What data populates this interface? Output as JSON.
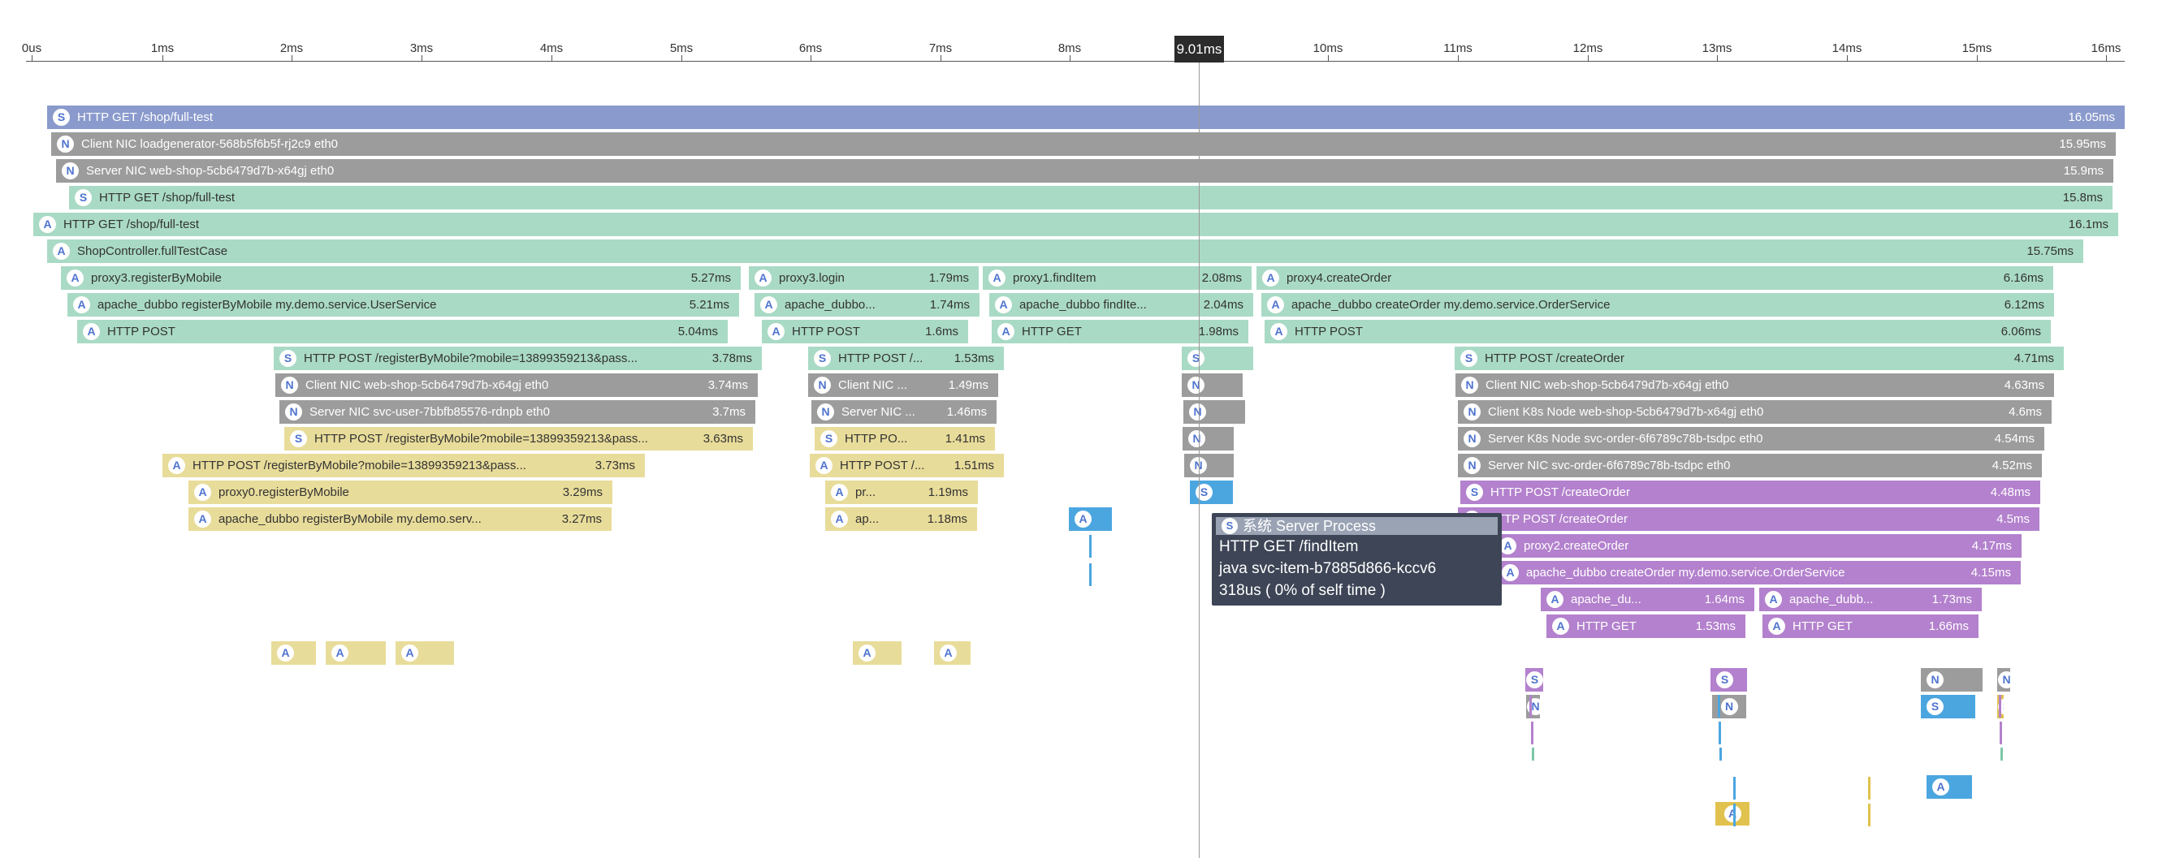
{
  "timeline": {
    "ticks": [
      "0us",
      "1ms",
      "2ms",
      "3ms",
      "4ms",
      "5ms",
      "6ms",
      "7ms",
      "8ms",
      "10ms",
      "11ms",
      "12ms",
      "13ms",
      "14ms",
      "15ms",
      "16ms"
    ],
    "cursor_label": "9.01ms"
  },
  "spans": [
    {
      "type": "S",
      "name": "HTTP GET /shop/full-test",
      "duration": "16.05ms",
      "color": "root"
    },
    {
      "type": "N",
      "name": "Client NIC loadgenerator-568b5f6b5f-rj2c9 eth0",
      "duration": "15.95ms",
      "color": "nic"
    },
    {
      "type": "N",
      "name": "Server NIC web-shop-5cb6479d7b-x64gj eth0",
      "duration": "15.9ms",
      "color": "nic"
    },
    {
      "type": "S",
      "name": "HTTP GET /shop/full-test",
      "duration": "15.8ms",
      "color": "app"
    },
    {
      "type": "A",
      "name": "HTTP GET /shop/full-test",
      "duration": "16.1ms",
      "color": "app"
    },
    {
      "type": "A",
      "name": "ShopController.fullTestCase",
      "duration": "15.75ms",
      "color": "app"
    },
    {
      "type": "A",
      "name": "proxy3.registerByMobile",
      "duration": "5.27ms",
      "color": "app"
    },
    {
      "type": "A",
      "name": "proxy3.login",
      "duration": "1.79ms",
      "color": "app"
    },
    {
      "type": "A",
      "name": "proxy1.findItem",
      "duration": "2.08ms",
      "color": "app"
    },
    {
      "type": "A",
      "name": "proxy4.createOrder",
      "duration": "6.16ms",
      "color": "app"
    },
    {
      "type": "A",
      "name": "apache_dubbo registerByMobile my.demo.service.UserService",
      "duration": "5.21ms",
      "color": "app"
    },
    {
      "type": "A",
      "name": "apache_dubbo...",
      "duration": "1.74ms",
      "color": "app"
    },
    {
      "type": "A",
      "name": "apache_dubbo findIte...",
      "duration": "2.04ms",
      "color": "app"
    },
    {
      "type": "A",
      "name": "apache_dubbo createOrder my.demo.service.OrderService",
      "duration": "6.12ms",
      "color": "app"
    },
    {
      "type": "A",
      "name": "HTTP POST",
      "duration": "5.04ms",
      "color": "app"
    },
    {
      "type": "A",
      "name": "HTTP POST",
      "duration": "1.6ms",
      "color": "app"
    },
    {
      "type": "A",
      "name": "HTTP GET",
      "duration": "1.98ms",
      "color": "app"
    },
    {
      "type": "A",
      "name": "HTTP POST",
      "duration": "6.06ms",
      "color": "app"
    },
    {
      "type": "S",
      "name": "HTTP POST /registerByMobile?mobile=13899359213&pass...",
      "duration": "3.78ms",
      "color": "app"
    },
    {
      "type": "S",
      "name": "HTTP POST /...",
      "duration": "1.53ms",
      "color": "app"
    },
    {
      "type": "S",
      "name": "",
      "duration": "",
      "color": "app"
    },
    {
      "type": "S",
      "name": "HTTP POST /createOrder",
      "duration": "4.71ms",
      "color": "app"
    },
    {
      "type": "N",
      "name": "Client NIC web-shop-5cb6479d7b-x64gj eth0",
      "duration": "3.74ms",
      "color": "nic"
    },
    {
      "type": "N",
      "name": "Client NIC ...",
      "duration": "1.49ms",
      "color": "nic"
    },
    {
      "type": "N",
      "name": "",
      "duration": "",
      "color": "nic"
    },
    {
      "type": "N",
      "name": "Client NIC web-shop-5cb6479d7b-x64gj eth0",
      "duration": "4.63ms",
      "color": "nic"
    },
    {
      "type": "N",
      "name": "Server NIC svc-user-7bbfb85576-rdnpb eth0",
      "duration": "3.7ms",
      "color": "nic"
    },
    {
      "type": "N",
      "name": "Server NIC ...",
      "duration": "1.46ms",
      "color": "nic"
    },
    {
      "type": "N",
      "name": "",
      "duration": "",
      "color": "nic"
    },
    {
      "type": "N",
      "name": "Client K8s Node web-shop-5cb6479d7b-x64gj eth0",
      "duration": "4.6ms",
      "color": "nic"
    },
    {
      "type": "S",
      "name": "HTTP POST /registerByMobile?mobile=13899359213&pass...",
      "duration": "3.63ms",
      "color": "user"
    },
    {
      "type": "S",
      "name": "HTTP PO...",
      "duration": "1.41ms",
      "color": "user"
    },
    {
      "type": "N",
      "name": "",
      "duration": "",
      "color": "nic"
    },
    {
      "type": "N",
      "name": "Server K8s Node svc-order-6f6789c78b-tsdpc eth0",
      "duration": "4.54ms",
      "color": "nic"
    },
    {
      "type": "A",
      "name": "HTTP POST /registerByMobile?mobile=13899359213&pass...",
      "duration": "3.73ms",
      "color": "user"
    },
    {
      "type": "A",
      "name": "HTTP POST /...",
      "duration": "1.51ms",
      "color": "user"
    },
    {
      "type": "N",
      "name": "",
      "duration": "",
      "color": "nic"
    },
    {
      "type": "N",
      "name": "Server NIC svc-order-6f6789c78b-tsdpc eth0",
      "duration": "4.52ms",
      "color": "nic"
    },
    {
      "type": "A",
      "name": "proxy0.registerByMobile",
      "duration": "3.29ms",
      "color": "user"
    },
    {
      "type": "A",
      "name": "pr...",
      "duration": "1.19ms",
      "color": "user"
    },
    {
      "type": "S",
      "name": "",
      "duration": "",
      "color": "item"
    },
    {
      "type": "S",
      "name": "HTTP POST /createOrder",
      "duration": "4.48ms",
      "color": "order"
    },
    {
      "type": "A",
      "name": "apache_dubbo registerByMobile my.demo.serv...",
      "duration": "3.27ms",
      "color": "user"
    },
    {
      "type": "A",
      "name": "ap...",
      "duration": "1.18ms",
      "color": "user"
    },
    {
      "type": "A",
      "name": "",
      "duration": "",
      "color": "item"
    },
    {
      "type": "A",
      "name": "HTTP POST /createOrder",
      "duration": "4.5ms",
      "color": "order"
    },
    {
      "type": "A",
      "name": "proxy2.createOrder",
      "duration": "4.17ms",
      "color": "order"
    },
    {
      "type": "A",
      "name": "apache_dubbo createOrder my.demo.service.OrderService",
      "duration": "4.15ms",
      "color": "order"
    },
    {
      "type": "A",
      "name": "apache_du...",
      "duration": "1.64ms",
      "color": "order"
    },
    {
      "type": "A",
      "name": "apache_dubb...",
      "duration": "1.73ms",
      "color": "order"
    },
    {
      "type": "A",
      "name": "HTTP GET",
      "duration": "1.53ms",
      "color": "order"
    },
    {
      "type": "A",
      "name": "HTTP GET",
      "duration": "1.66ms",
      "color": "order"
    },
    {
      "type": "A",
      "name": "",
      "duration": "",
      "color": "user"
    },
    {
      "type": "A",
      "name": "",
      "duration": "",
      "color": "user"
    },
    {
      "type": "A",
      "name": "",
      "duration": "",
      "color": "user"
    },
    {
      "type": "A",
      "name": "",
      "duration": "",
      "color": "user"
    },
    {
      "type": "A",
      "name": "",
      "duration": "",
      "color": "user"
    },
    {
      "type": "S",
      "name": "",
      "duration": "",
      "color": "order"
    },
    {
      "type": "S",
      "name": "",
      "duration": "",
      "color": "order"
    },
    {
      "type": "N",
      "name": "",
      "duration": "",
      "color": "nic"
    },
    {
      "type": "N",
      "name": "",
      "duration": "",
      "color": "nic"
    },
    {
      "type": "N",
      "name": "",
      "duration": "",
      "color": "nic"
    },
    {
      "type": "N",
      "name": "",
      "duration": "",
      "color": "nic"
    },
    {
      "type": "S",
      "name": "",
      "duration": "",
      "color": "item"
    },
    {
      "type": "S",
      "name": "",
      "duration": "",
      "color": "gold"
    },
    {
      "type": "A",
      "name": "",
      "duration": "",
      "color": "item"
    },
    {
      "type": "A",
      "name": "",
      "duration": "",
      "color": "gold"
    }
  ],
  "tooltip": {
    "badge": "S",
    "header": "系统 Server Process",
    "endpoint": "HTTP GET /findItem",
    "process": "java svc-item-b7885d866-kccv6",
    "time": "318us ( 0% of self time )"
  }
}
